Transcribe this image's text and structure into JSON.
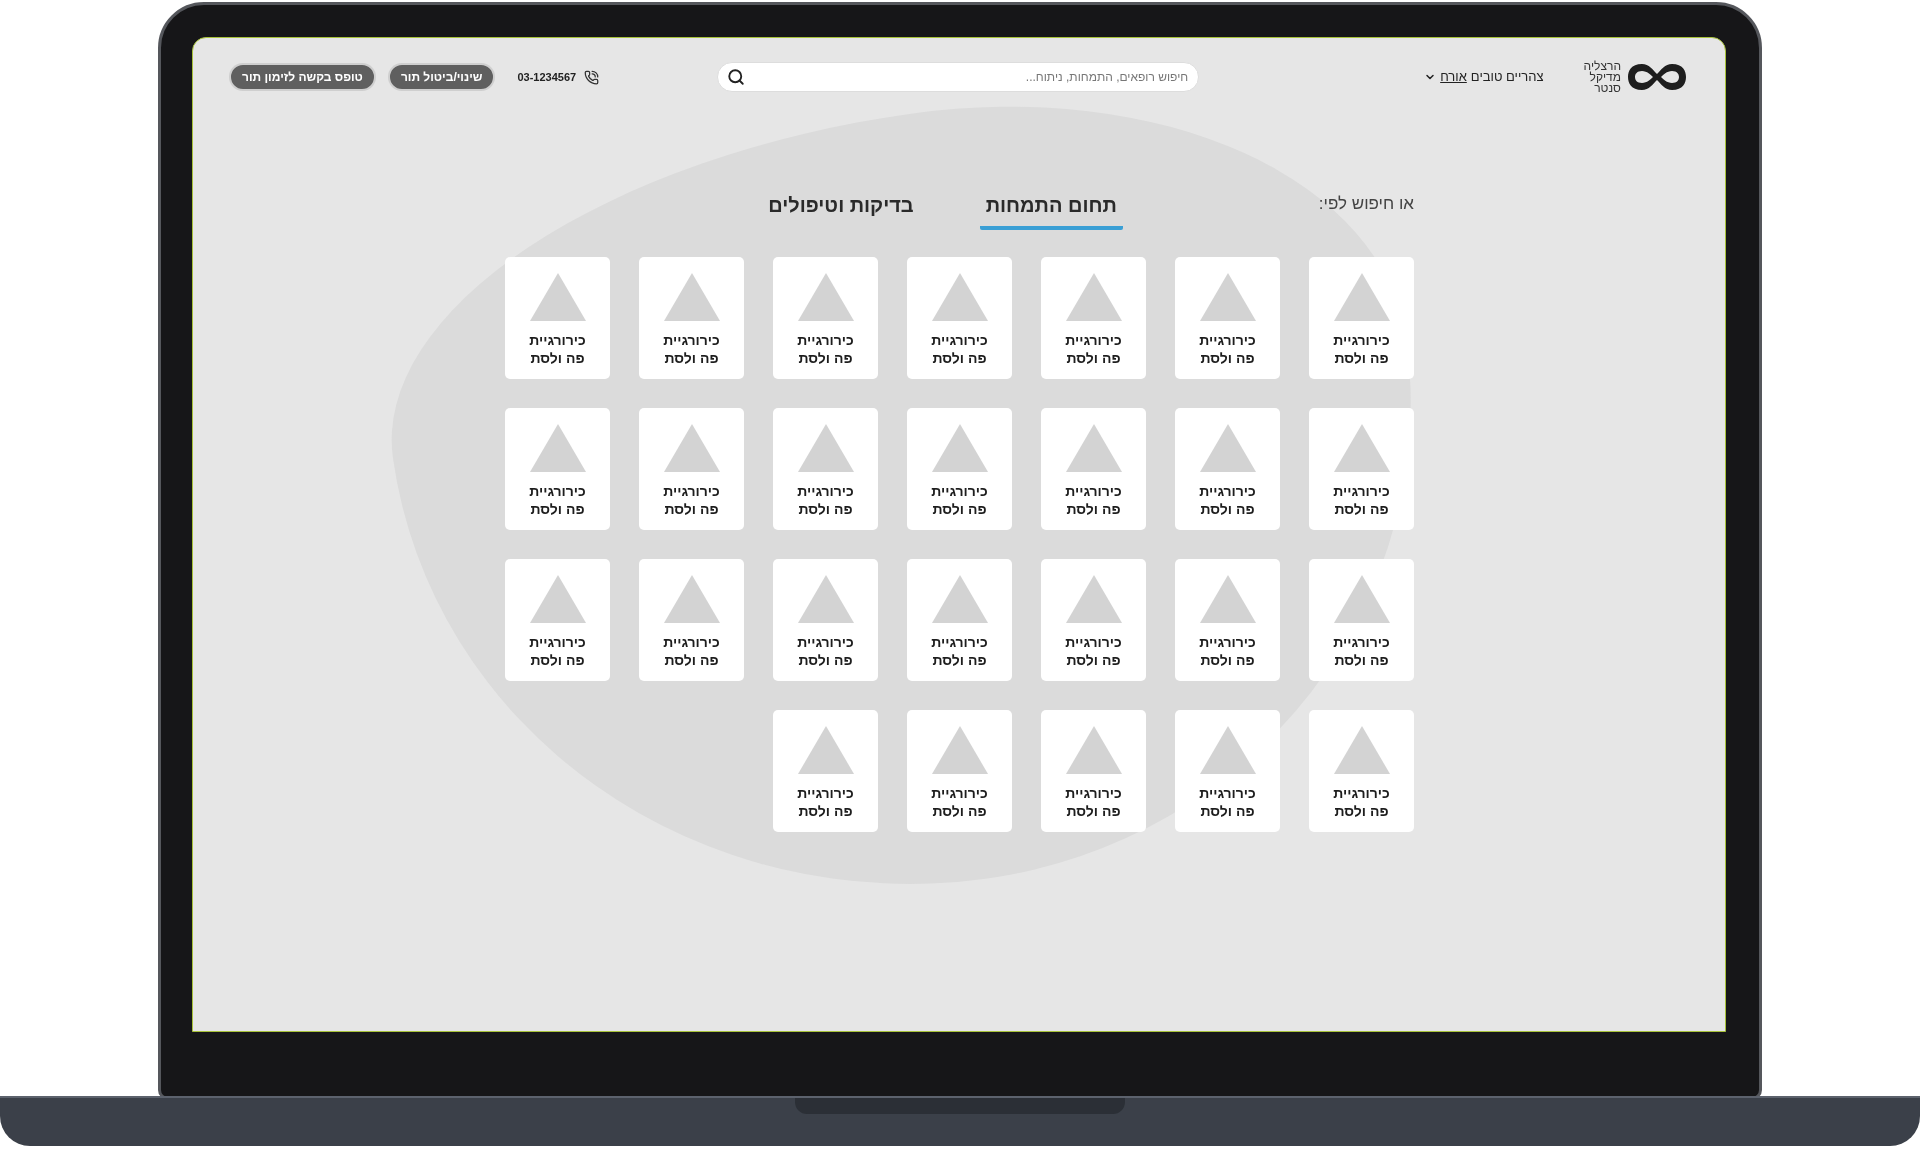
{
  "header": {
    "logo": {
      "lines": [
        "הרצליה",
        "מדיקל",
        "סנטר"
      ]
    },
    "user_menu": {
      "greeting": "צהריים טובים",
      "name": "אורח"
    },
    "search": {
      "placeholder": "חיפוש רופאים, התמחות, ניתוח..."
    },
    "phone": "03-1234567",
    "buttons": [
      "שינוי/ביטול תור",
      "טופס בקשה לזימון תור"
    ]
  },
  "search_by": {
    "label": "או חיפוש לפי:",
    "tabs": [
      {
        "label": "תחום התמחות",
        "selected": true
      },
      {
        "label": "בדיקות וטיפולים",
        "selected": false
      }
    ]
  },
  "cards": [
    {
      "title": "כירורגיית פה ולסת"
    },
    {
      "title": "כירורגיית פה ולסת"
    },
    {
      "title": "כירורגיית פה ולסת"
    },
    {
      "title": "כירורגיית פה ולסת"
    },
    {
      "title": "כירורגיית פה ולסת"
    },
    {
      "title": "כירורגיית פה ולסת"
    },
    {
      "title": "כירורגיית פה ולסת"
    },
    {
      "title": "כירורגיית פה ולסת"
    },
    {
      "title": "כירורגיית פה ולסת"
    },
    {
      "title": "כירורגיית פה ולסת"
    },
    {
      "title": "כירורגיית פה ולסת"
    },
    {
      "title": "כירורגיית פה ולסת"
    },
    {
      "title": "כירורגיית פה ולסת"
    },
    {
      "title": "כירורגיית פה ולסת"
    },
    {
      "title": "כירורגיית פה ולסת"
    },
    {
      "title": "כירורגיית פה ולסת"
    },
    {
      "title": "כירורגיית פה ולסת"
    },
    {
      "title": "כירורגיית פה ולסת"
    },
    {
      "title": "כירורגיית פה ולסת"
    },
    {
      "title": "כירורגיית פה ולסת"
    },
    {
      "title": "כירורגיית פה ולסת"
    },
    {
      "title": "כירורגיית פה ולסת"
    },
    {
      "title": "כירורגיית פה ולסת"
    },
    {
      "title": "כירורגיית פה ולסת"
    },
    {
      "title": "כירורגיית פה ולסת"
    },
    {
      "title": "כירורגיית פה ולסת"
    }
  ]
}
